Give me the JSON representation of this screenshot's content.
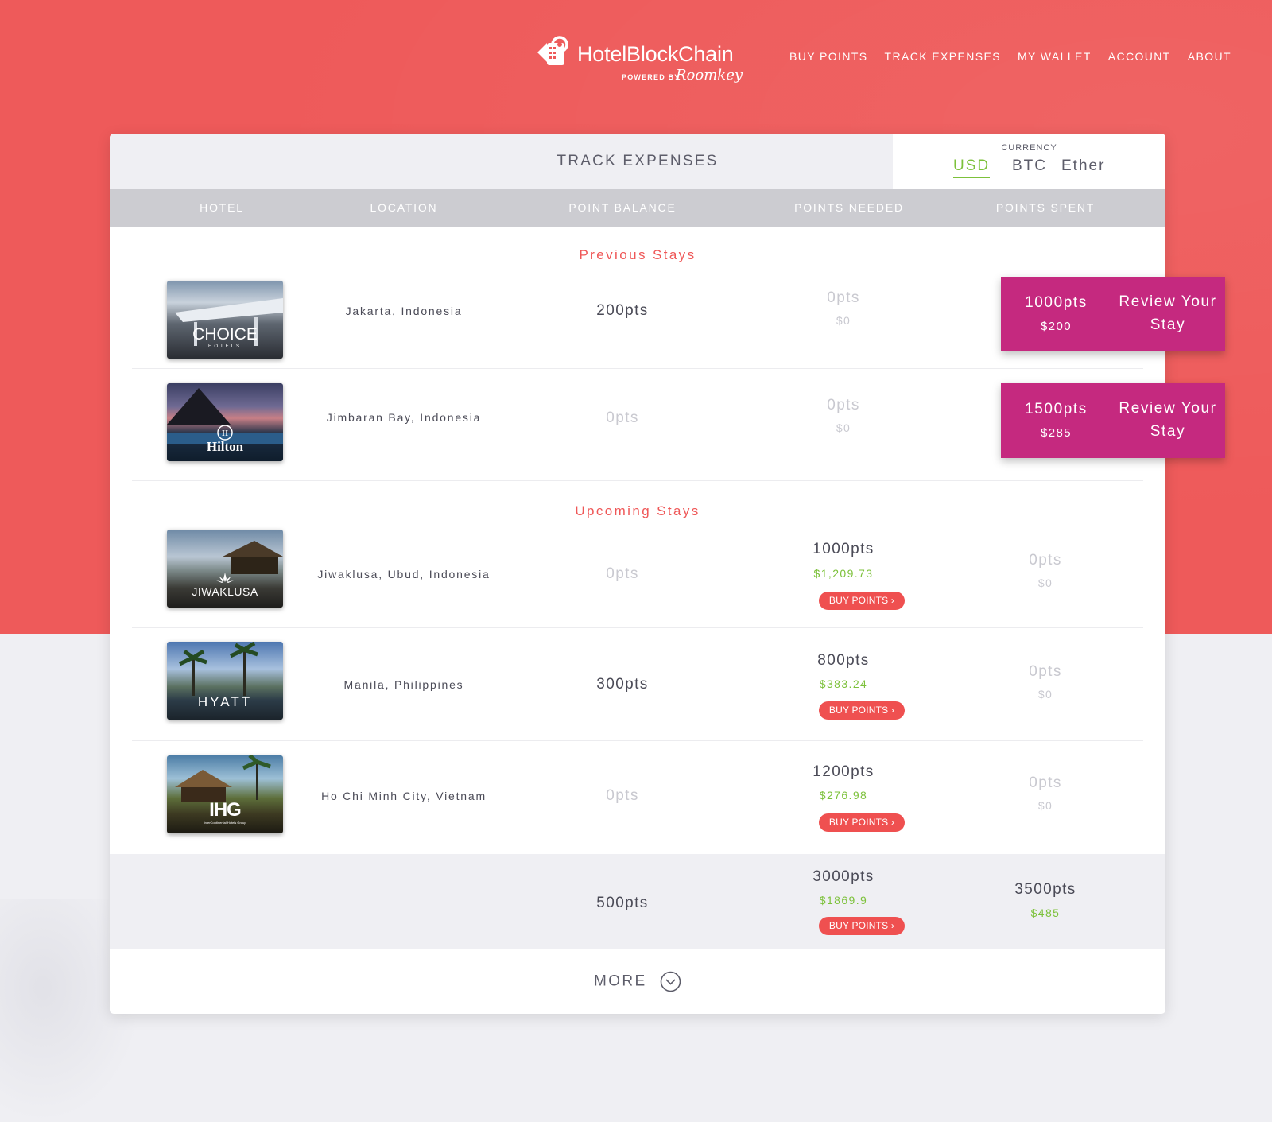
{
  "brand": {
    "name": "HotelBlockChain",
    "powered_by": "POWERED BY",
    "partner": "Roomkey"
  },
  "nav": [
    "BUY POINTS",
    "TRACK EXPENSES",
    "MY WALLET",
    "ACCOUNT",
    "ABOUT"
  ],
  "card": {
    "title": "TRACK EXPENSES",
    "currency_label": "CURRENCY",
    "currency_options": [
      "USD",
      "BTC",
      "Ether"
    ],
    "currency_selected": "USD",
    "columns": [
      "HOTEL",
      "LOCATION",
      "POINT BALANCE",
      "POINTS NEEDED",
      "POINTS SPENT"
    ]
  },
  "sections": {
    "previous": "Previous Stays",
    "upcoming": "Upcoming Stays"
  },
  "previous_stays": [
    {
      "hotel_brand": "CHOICE",
      "hotel_sub": "HOTELS",
      "location": "Jakarta, Indonesia",
      "point_balance": "200pts",
      "points_needed": "0pts",
      "points_needed_value": "$0",
      "points_spent": "1000pts",
      "points_spent_value": "$200",
      "review_label": "Review Your Stay"
    },
    {
      "hotel_brand": "Hilton",
      "hotel_sub": "",
      "location": "Jimbaran Bay, Indonesia",
      "point_balance": "0pts",
      "points_needed": "0pts",
      "points_needed_value": "$0",
      "points_spent": "1500pts",
      "points_spent_value": "$285",
      "review_label": "Review Your Stay"
    }
  ],
  "upcoming_stays": [
    {
      "hotel_brand": "JIWAKLUSA",
      "location": "Jiwaklusa, Ubud, Indonesia",
      "point_balance": "0pts",
      "points_needed": "1000pts",
      "points_needed_value": "$1,209.73",
      "buy_label": "BUY POINTS ›",
      "points_spent": "0pts",
      "points_spent_value": "$0"
    },
    {
      "hotel_brand": "HYATT",
      "location": "Manila, Philippines",
      "point_balance": "300pts",
      "points_needed": "800pts",
      "points_needed_value": "$383.24",
      "buy_label": "BUY POINTS ›",
      "points_spent": "0pts",
      "points_spent_value": "$0"
    },
    {
      "hotel_brand": "IHG",
      "hotel_sub": "InterContinental Hotels Group",
      "location": "Ho Chi Minh City, Vietnam",
      "point_balance": "0pts",
      "points_needed": "1200pts",
      "points_needed_value": "$276.98",
      "buy_label": "BUY POINTS ›",
      "points_spent": "0pts",
      "points_spent_value": "$0"
    }
  ],
  "totals": {
    "point_balance": "500pts",
    "points_needed": "3000pts",
    "points_needed_value": "$1869.9",
    "buy_label": "BUY POINTS ›",
    "points_spent": "3500pts",
    "points_spent_value": "$485"
  },
  "more_label": "MORE",
  "colors": {
    "hero": "#ee5a5a",
    "accent_green": "#7cc13a",
    "section_red": "#ef5757",
    "review_magenta": "#c5297f",
    "buy_red": "#ef5050"
  },
  "icons": {
    "logo": "ticket-key-icon",
    "more": "chevron-down-circle-icon"
  }
}
